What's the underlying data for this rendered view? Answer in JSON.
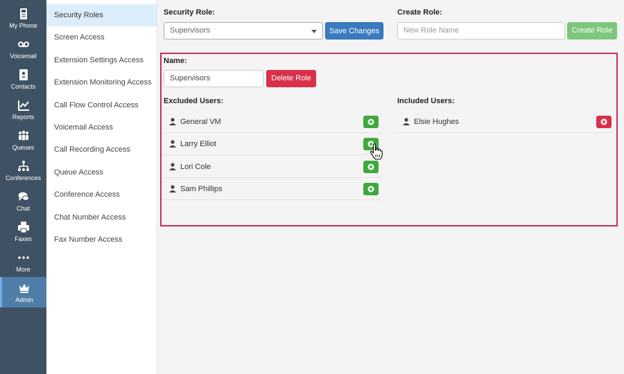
{
  "nav": [
    {
      "label": "My Phone",
      "icon": "phone-icon"
    },
    {
      "label": "Voicemail",
      "icon": "voicemail-icon"
    },
    {
      "label": "Contacts",
      "icon": "contacts-icon"
    },
    {
      "label": "Reports",
      "icon": "reports-icon"
    },
    {
      "label": "Queues",
      "icon": "queues-icon"
    },
    {
      "label": "Conferences",
      "icon": "conferences-icon"
    },
    {
      "label": "Chat",
      "icon": "chat-icon"
    },
    {
      "label": "Faxes",
      "icon": "fax-icon"
    },
    {
      "label": "More",
      "icon": "more-icon"
    },
    {
      "label": "Admin",
      "icon": "crown-icon",
      "active": true
    }
  ],
  "subnav": [
    "Security Roles",
    "Screen Access",
    "Extension Settings Access",
    "Extension Monitoring Access",
    "Call Flow Control Access",
    "Voicemail Access",
    "Call Recording Access",
    "Queue Access",
    "Conference Access",
    "Chat Number Access",
    "Fax Number Access"
  ],
  "security_role": {
    "label": "Security Role:",
    "selected": "Supervisors",
    "save_label": "Save Changes"
  },
  "create_role": {
    "label": "Create Role:",
    "placeholder": "New Role Name",
    "button_label": "Create Role"
  },
  "role_panel": {
    "name_label": "Name:",
    "name_value": "Supervisors",
    "delete_label": "Delete Role",
    "excluded_label": "Excluded Users:",
    "included_label": "Included Users:",
    "excluded_users": [
      "General VM",
      "Larry Elliot",
      "Lori Cole",
      "Sam Phillips"
    ],
    "included_users": [
      "Elsie Hughes"
    ]
  },
  "colors": {
    "nav_bg": "#3f5263",
    "nav_active": "#4e7ea8",
    "highlight_border": "#cc2a5e",
    "add_green": "#3fa93f",
    "remove_red": "#d9304a",
    "save_blue": "#3a7bc0"
  }
}
